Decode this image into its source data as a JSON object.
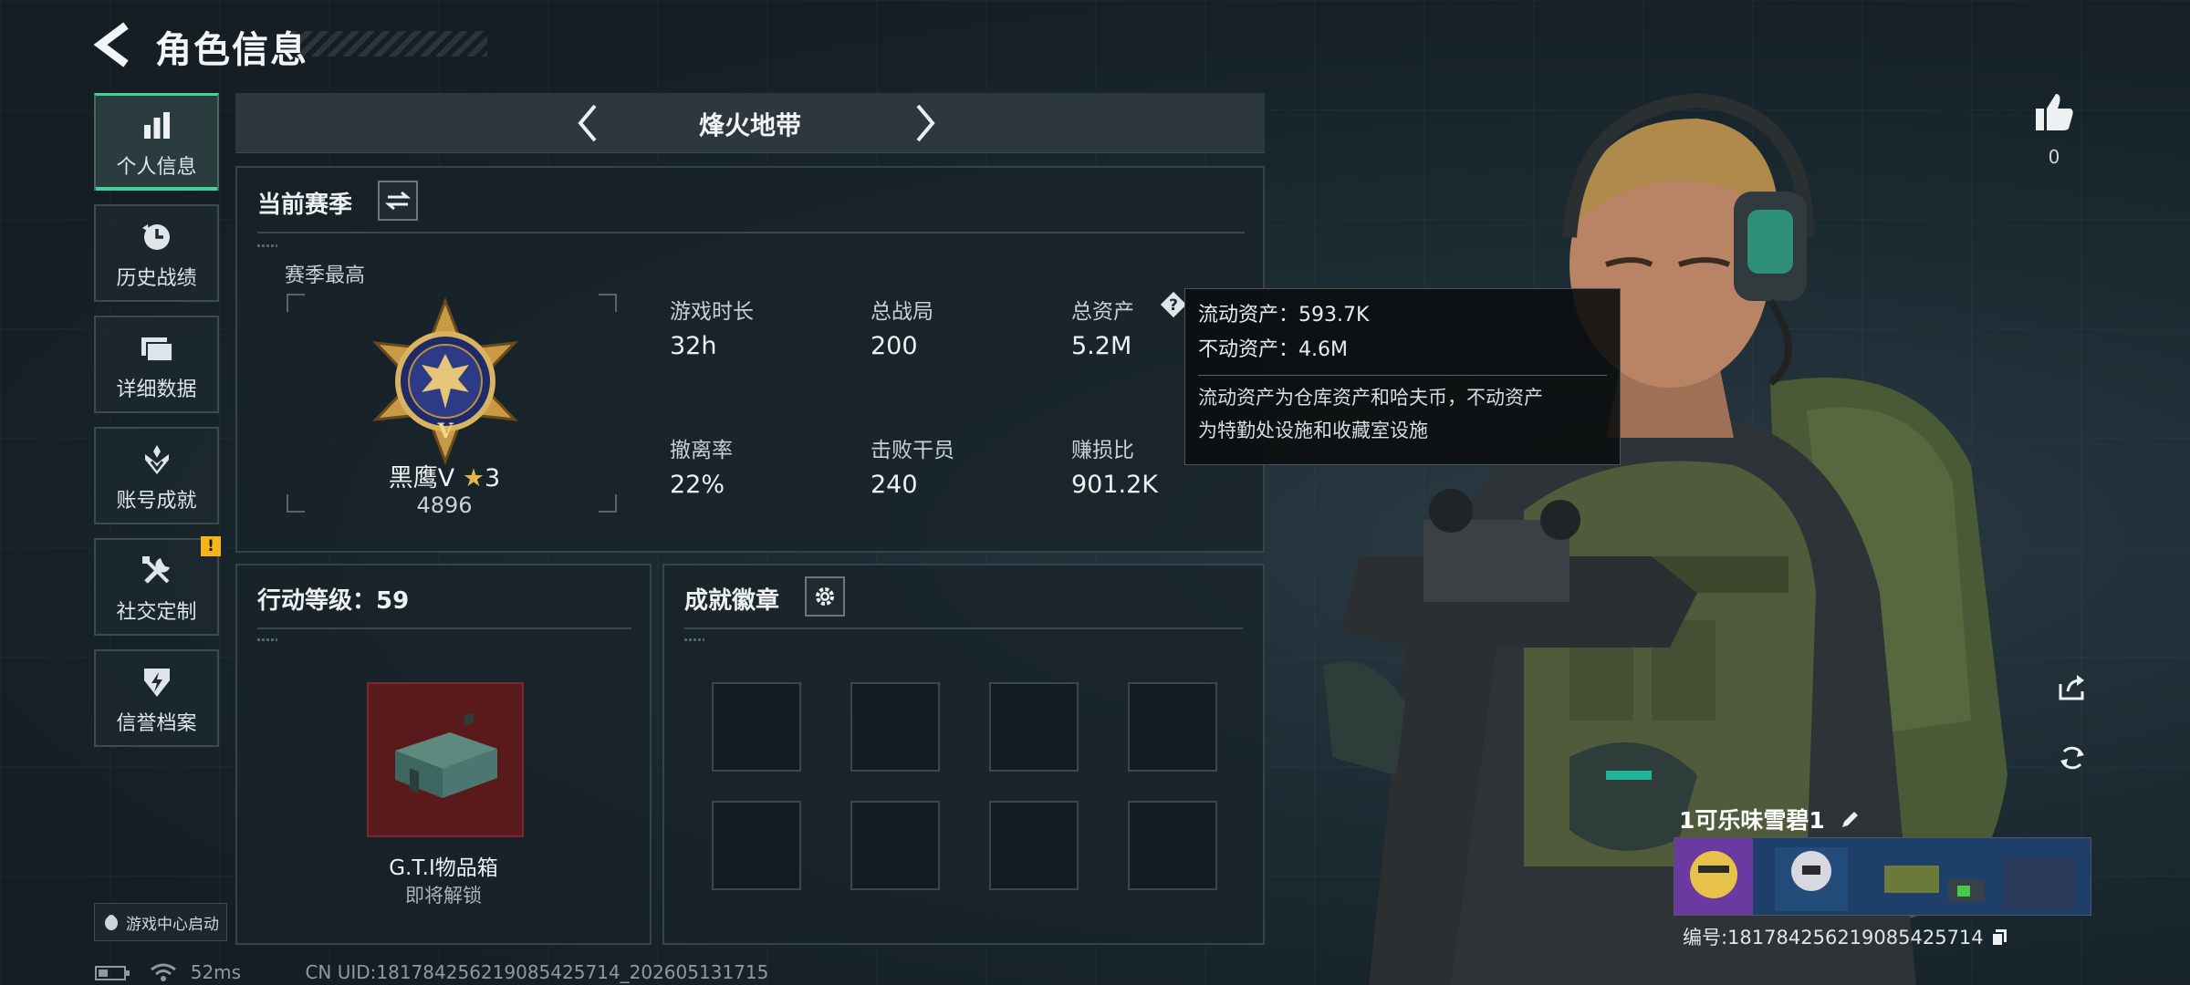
{
  "header": {
    "title": "角色信息"
  },
  "sidebar": {
    "items": [
      {
        "label": "个人信息",
        "icon": "bar-chart-icon",
        "active": true
      },
      {
        "label": "历史战绩",
        "icon": "history-clock-icon"
      },
      {
        "label": "详细数据",
        "icon": "folder-icon"
      },
      {
        "label": "账号成就",
        "icon": "achievement-icon"
      },
      {
        "label": "社交定制",
        "icon": "tools-icon",
        "alert": "!"
      },
      {
        "label": "信誉档案",
        "icon": "shield-lightning-icon"
      }
    ],
    "game_center": "游戏中心启动"
  },
  "mode_bar": {
    "name": "烽火地带"
  },
  "season": {
    "title": "当前赛季",
    "best_label": "赛季最高",
    "rank_name": "黑鹰Ⅴ",
    "rank_stars": "3",
    "rank_points": "4896",
    "stats": [
      {
        "label": "游戏时长",
        "value": "32h"
      },
      {
        "label": "总战局",
        "value": "200"
      },
      {
        "label": "总资产",
        "value": "5.2M"
      },
      {
        "label": "撤离率",
        "value": "22%"
      },
      {
        "label": "击败干员",
        "value": "240"
      },
      {
        "label": "赚损比",
        "value": "901.2K"
      }
    ]
  },
  "tooltip": {
    "liquid": "流动资产：593.7K",
    "fixed": "不动资产：4.6M",
    "desc_line1": "流动资产为仓库资产和哈夫币，不动资产",
    "desc_line2": "为特勤处设施和收藏室设施"
  },
  "action_level": {
    "title": "行动等级：59",
    "reward_name": "G.T.I物品箱",
    "reward_status": "即将解锁"
  },
  "badges": {
    "title": "成就徽章",
    "slot_count": 8
  },
  "likes": {
    "count": "0"
  },
  "player": {
    "name": "1可乐味雪碧1",
    "id": "编号:1817842562190854257​14"
  },
  "status": {
    "ping": "52ms",
    "uid": "CN UID:18178425621908542571​4_202605131715"
  },
  "colors": {
    "accent": "#3fd39b",
    "alert": "#f2b51a",
    "reward_bg": "#5a1a1c"
  }
}
